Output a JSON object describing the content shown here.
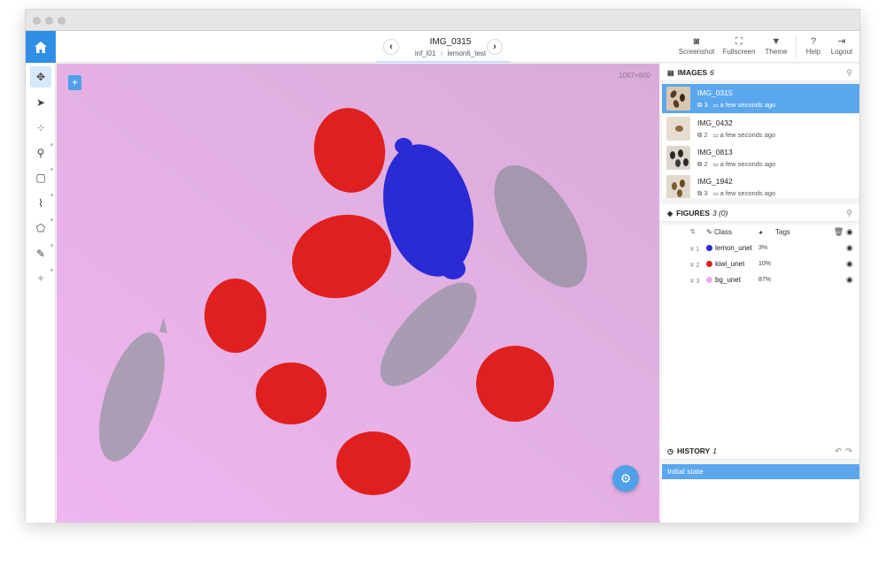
{
  "header": {
    "image_title": "IMG_0315",
    "breadcrumb_project": "inf_l01",
    "breadcrumb_sep": "›",
    "breadcrumb_dataset": "lemon6_test",
    "prev_icon": "chevron-left-icon",
    "next_icon": "chevron-right-icon",
    "tools": [
      {
        "label": "Screenshot",
        "icon": "camera-icon"
      },
      {
        "label": "Fullscreen",
        "icon": "fullscreen-icon"
      },
      {
        "label": "Theme",
        "icon": "theme-icon"
      },
      {
        "label": "Help",
        "icon": "help-icon"
      },
      {
        "label": "Logout",
        "icon": "logout-icon"
      }
    ]
  },
  "left_toolbar": {
    "tools": [
      "move-icon",
      "pointer-icon",
      "points-icon",
      "skeleton-icon",
      "bbox-icon",
      "polyline-icon",
      "polygon-icon",
      "brush-icon",
      "magic-wand-icon"
    ],
    "active_tool": "move-icon"
  },
  "canvas": {
    "dimensions_label": "1067×800",
    "add_label": "+",
    "settings_icon": "sliders-icon",
    "background_color": "#e3b2e6"
  },
  "images_panel": {
    "title": "IMAGES",
    "count": "6",
    "items": [
      {
        "name": "IMG_0315",
        "figures": "3",
        "time": "a few seconds ago",
        "selected": true
      },
      {
        "name": "IMG_0432",
        "figures": "2",
        "time": "a few seconds ago",
        "selected": false
      },
      {
        "name": "IMG_0813",
        "figures": "2",
        "time": "a few seconds ago",
        "selected": false
      },
      {
        "name": "IMG_1942",
        "figures": "3",
        "time": "a few seconds ago",
        "selected": false
      }
    ]
  },
  "figures_panel": {
    "title": "FIGURES",
    "count": "3 (0)",
    "columns": {
      "class": "Class",
      "tags": "Tags"
    },
    "rows": [
      {
        "num": "# 1",
        "class": "lemon_unet",
        "percent": "3%",
        "color": "#2a2ad6"
      },
      {
        "num": "# 2",
        "class": "kiwi_unet",
        "percent": "10%",
        "color": "#e01f1f"
      },
      {
        "num": "# 3",
        "class": "bg_unet",
        "percent": "87%",
        "color": "#f0a8ee"
      }
    ]
  },
  "history_panel": {
    "title": "HISTORY",
    "count": "1",
    "items": [
      "Initial state"
    ]
  },
  "colors": {
    "accent": "#2f8fe6",
    "selected_row": "#5aa7ee",
    "kiwi": "#e01f1f",
    "lemon": "#2a2ad6",
    "cucumber": "#a898b0"
  }
}
